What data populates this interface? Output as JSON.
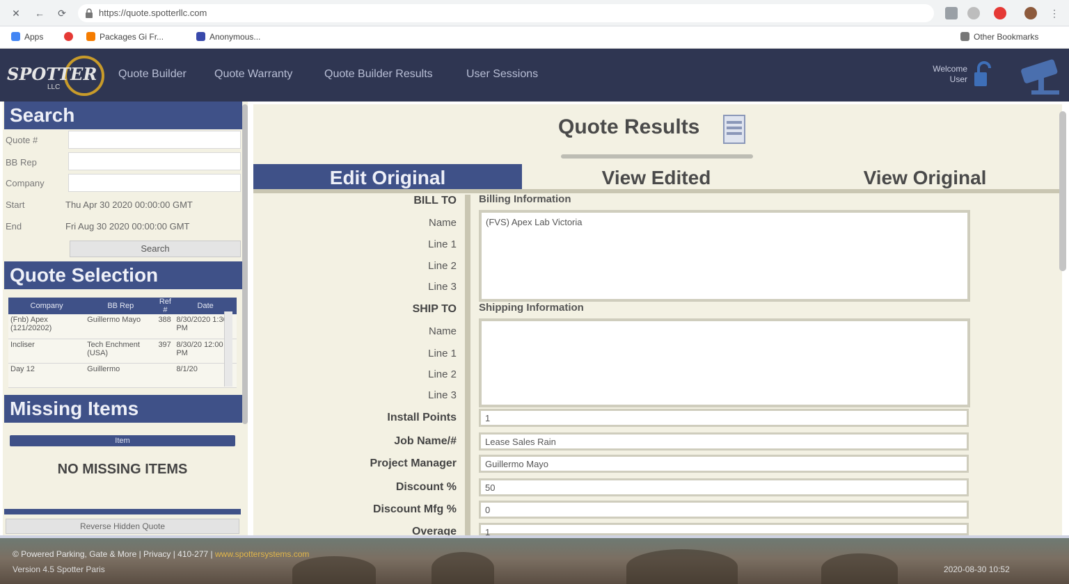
{
  "browser": {
    "url": "https://quote.spotterllc.com",
    "bookmarks": [
      "Apps",
      "Packages Gi Fr...",
      "Anonymous..."
    ],
    "other_bookmarks": "Other Bookmarks"
  },
  "header": {
    "logo_text": "SPOTTER",
    "logo_sub": "LLC",
    "nav": [
      "Quote Builder",
      "Quote Warranty",
      "Quote Builder Results",
      "User Sessions"
    ],
    "user_line1": "Welcome",
    "user_line2": "User"
  },
  "sidebar": {
    "search_title": "Search",
    "search_fields": [
      "Quote #",
      "BB Rep",
      "Company",
      "Start",
      "End"
    ],
    "start_value": "Thu Apr 30 2020 00:00:00 GMT",
    "end_value": "Fri Aug 30 2020 00:00:00 GMT",
    "search_button": "Search",
    "selection_title": "Quote Selection",
    "table_headers": [
      "Company",
      "BB Rep",
      "Ref #",
      "Date"
    ],
    "table_rows": [
      [
        "(Fnb) Apex (121/20202)",
        "Guillermo Mayo",
        "388",
        "8/30/2020 1:30 PM"
      ],
      [
        "Incliser",
        "Tech Enchment (USA)",
        "397",
        "8/30/20 12:00 PM"
      ],
      [
        "Day 12",
        "Guillermo",
        "",
        "8/1/20"
      ]
    ],
    "missing_title": "Missing Items",
    "missing_header": "Item",
    "no_missing": "NO MISSING ITEMS",
    "hidden_button": "Reverse Hidden Quote"
  },
  "main": {
    "title": "Quote Results",
    "tabs": [
      "Edit Original",
      "View Edited",
      "View Original"
    ],
    "bill_to": "BILL TO",
    "ship_to": "SHIP TO",
    "bill_fields": [
      "Name",
      "Line 1",
      "Line 2",
      "Line 3"
    ],
    "ship_fields": [
      "Name",
      "Line 1",
      "Line 2",
      "Line 3"
    ],
    "billing_label": "Billing Information",
    "billing_value": "(FVS) Apex Lab Victoria",
    "shipping_label": "Shipping Information",
    "shipping_value": "",
    "form_labels": [
      "Install Points",
      "Job Name/#",
      "Project Manager",
      "Discount %",
      "Discount Mfg %",
      "Overage"
    ],
    "form_values": [
      "1",
      "Lease Sales Rain",
      "Guillermo Mayo",
      "50",
      "0",
      "1"
    ]
  },
  "footer": {
    "text": "© Powered Parking, Gate & More | Privacy | 410-277 |",
    "link": "www.spottersystems.com",
    "sub": "Version 4.5 Spotter Paris",
    "time": "2020-08-30 10:52"
  }
}
